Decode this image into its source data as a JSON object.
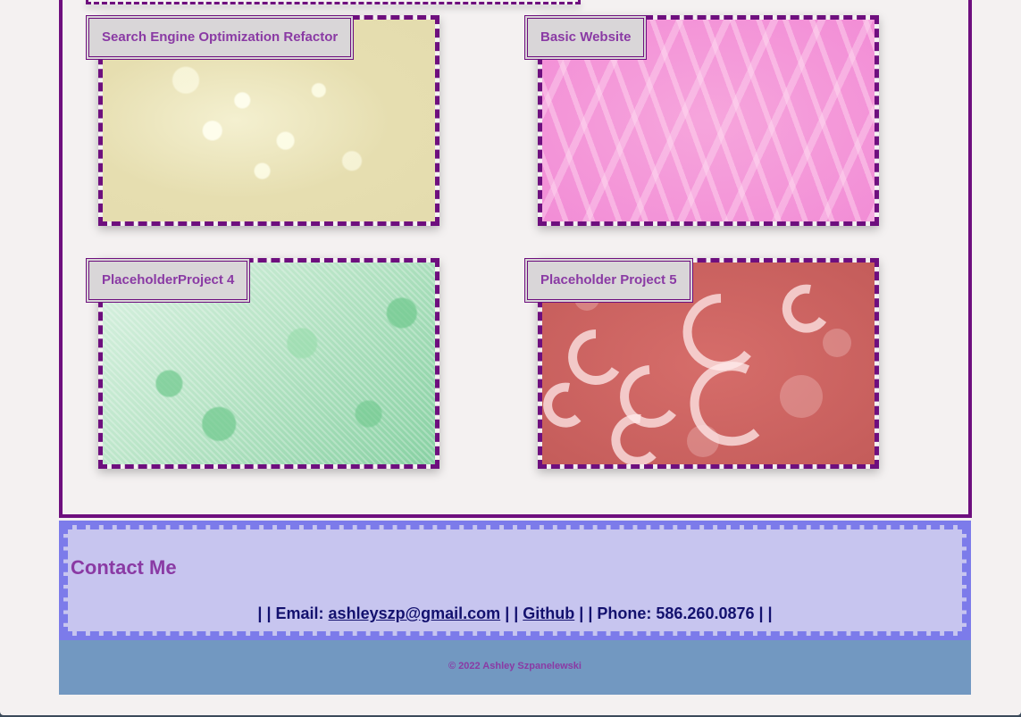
{
  "projects": [
    {
      "title": "Search Engine Optimization Refactor",
      "image": "golden-bokeh-web-image"
    },
    {
      "title": "Basic Website",
      "image": "pink-scratched-texture-image"
    },
    {
      "title": "PlaceholderProject 4",
      "image": "green-floral-lace-image"
    },
    {
      "title": "Placeholder Project 5",
      "image": "coral-crescent-bokeh-image"
    }
  ],
  "contact": {
    "title": "Contact Me",
    "sep": "| |",
    "email_label": "Email:",
    "email": "ashleyszp@gmail.com",
    "github": "Github",
    "phone_label": "Phone:",
    "phone": "586.260.0876"
  },
  "footer": {
    "copyright": "© 2022 Ashley Szpanelewski"
  },
  "colors": {
    "border_purple": "#6e0f7e",
    "label_purple": "#8a3aa4",
    "contact_dash": "#7c7bea",
    "contact_bg": "#c7c5ef",
    "footer_bg": "#7298c1",
    "link_navy": "#13116e"
  }
}
